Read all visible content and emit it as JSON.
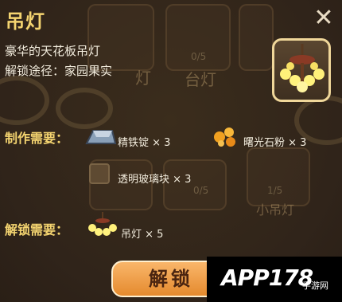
{
  "dialog": {
    "title": "吊灯",
    "close_icon": "close-icon",
    "description": "豪华的天花板吊灯",
    "unlock_path": "解锁途径：家园果实",
    "item_icon": "chandelier-icon"
  },
  "crafting": {
    "label": "制作需要：",
    "materials": [
      {
        "name": "精铁锭",
        "qty": "× 3",
        "icon": "iron-ingot-icon"
      },
      {
        "name": "曙光石粉",
        "qty": "× 3",
        "icon": "dawnstone-powder-icon"
      },
      {
        "name": "透明玻璃块",
        "qty": "× 3",
        "icon": "glass-block-icon"
      }
    ]
  },
  "unlock": {
    "label": "解锁需要：",
    "requirement": {
      "name": "吊灯",
      "qty": "× 5",
      "icon": "chandelier-icon"
    }
  },
  "button": {
    "label": "解锁"
  },
  "background": {
    "labels": [
      "灯",
      "台灯",
      "小吊灯"
    ],
    "counters": [
      "0/5",
      "0/5",
      "1/5"
    ]
  },
  "watermark": {
    "text": "APP178",
    "sub": "手游网"
  },
  "colors": {
    "accent_text": "#f4d470",
    "button": "#f0a050",
    "panel": "#33261a"
  }
}
